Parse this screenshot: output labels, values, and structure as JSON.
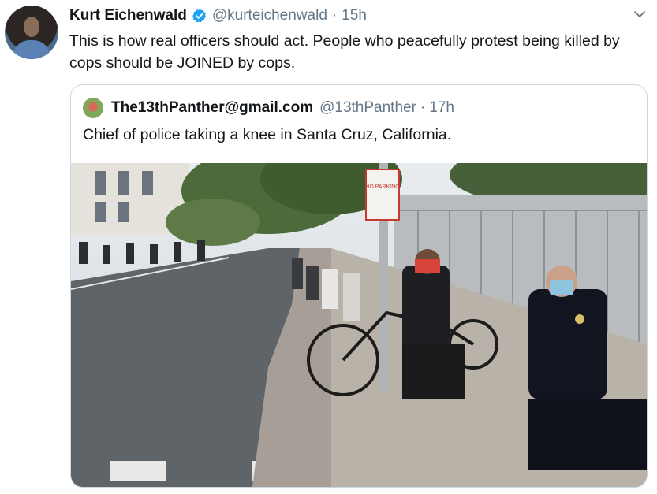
{
  "tweet": {
    "author_name": "Kurt Eichenwald",
    "author_handle": "@kurteichenwald",
    "separator": "·",
    "time": "15h",
    "text": "This is how real officers should act. People who peacefully protest being killed by cops should be JOINED by cops."
  },
  "quoted_tweet": {
    "author_name": "The13thPanther@gmail.com",
    "author_handle": "@13thPanther",
    "separator": "·",
    "time": "17h",
    "text": "Chief of police taking a knee in Santa Cruz, California."
  },
  "photo": {
    "sign_text": "NO PARKING ANY TIME"
  },
  "colors": {
    "text_primary": "#14171a",
    "text_secondary": "#657786",
    "border": "#ccd6dd",
    "verified_blue": "#1da1f2"
  },
  "icons": [
    "verified-badge-icon",
    "chevron-down-icon"
  ]
}
